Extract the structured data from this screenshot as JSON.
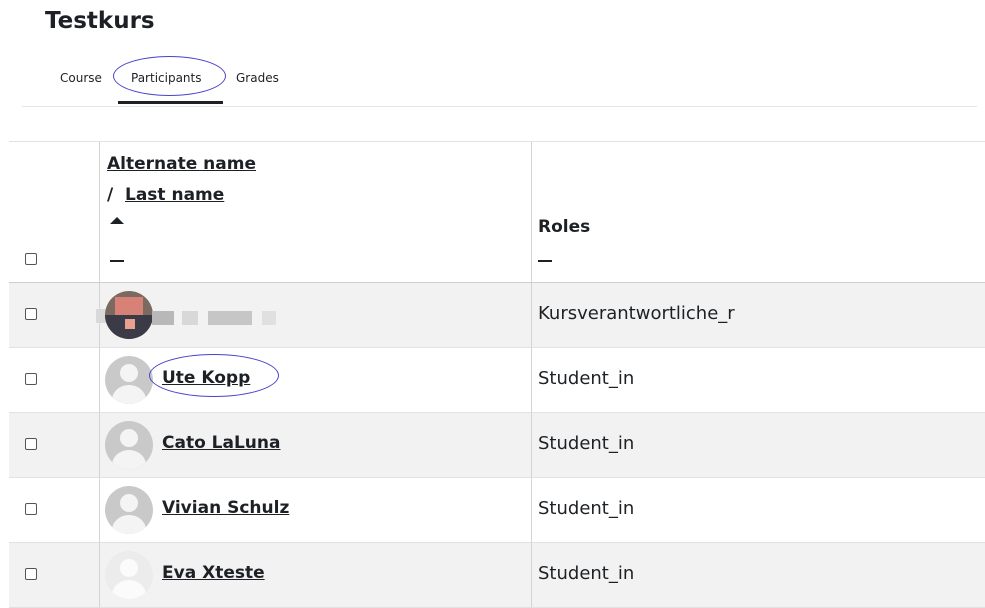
{
  "course": {
    "title": "Testkurs"
  },
  "nav": {
    "tabs": [
      {
        "label": "Course"
      },
      {
        "label": "Participants",
        "active": true
      },
      {
        "label": "Grades"
      }
    ]
  },
  "table": {
    "header": {
      "first_sort": "Alternate name",
      "separator": "/",
      "second_sort": "Last name",
      "roles": "Roles"
    },
    "rows": [
      {
        "name": "",
        "role": "Kursverantwortliche_r",
        "avatar": "photo-blurred"
      },
      {
        "name": "Ute Kopp",
        "role": "Student_in",
        "avatar": "default"
      },
      {
        "name": "Cato LaLuna",
        "role": "Student_in",
        "avatar": "default"
      },
      {
        "name": "Vivian Schulz",
        "role": "Student_in",
        "avatar": "default"
      },
      {
        "name": "Eva Xteste",
        "role": "Student_in",
        "avatar": "default-light"
      }
    ]
  },
  "colors": {
    "text": "#1d2125",
    "highlight_ellipse": "#4a43c9",
    "stripe": "#f2f2f2"
  }
}
